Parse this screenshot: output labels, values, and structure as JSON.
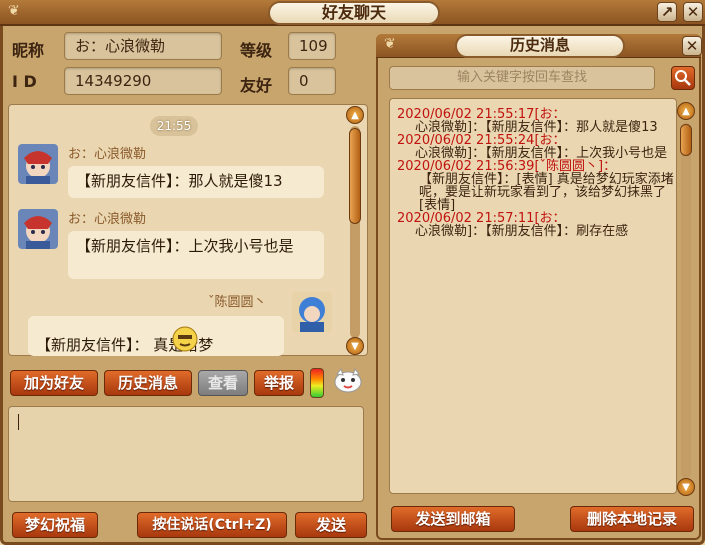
{
  "window": {
    "title": "好友聊天"
  },
  "profile": {
    "nickname_label": "昵称",
    "nickname_value": "お：心浪微勒",
    "level_label": "等级",
    "level_value": "109",
    "id_label": "I D",
    "id_value": "14349290",
    "friendship_label": "友好",
    "friendship_value": "0"
  },
  "chat": {
    "time": "21:55",
    "messages": [
      {
        "sender": "お：心浪微勒",
        "text": "【新朋友信件】：那人就是傻13"
      },
      {
        "sender": "お：心浪微勒",
        "text": "【新朋友信件】：上次我小号也是"
      },
      {
        "sender": "ˇ陈圆圆丶",
        "text": "【新朋友信件】：  真是给梦"
      }
    ]
  },
  "toolbar": {
    "add_friend": "加为好友",
    "history": "历史消息",
    "view": "查看",
    "report": "举报"
  },
  "bottom": {
    "blessing": "梦幻祝福",
    "voice": "按住说话(Ctrl+Z)",
    "send": "发送"
  },
  "history": {
    "title": "历史消息",
    "search_placeholder": "输入关键字按回车查找",
    "entries": [
      {
        "time": "2020/06/02 21:55:17[お：",
        "body": "心浪微勒]：【新朋友信件】：那人就是傻13"
      },
      {
        "time": "2020/06/02 21:55:24[お：",
        "body": "心浪微勒]：【新朋友信件】：上次我小号也是"
      },
      {
        "time": "2020/06/02 21:56:39[ˇ陈圆圆丶]：",
        "body": "【新朋友信件】：[表情] 真是给梦幻玩家添堵呢，要是让新玩家看到了，该给梦幻抹黑了[表情]"
      },
      {
        "time": "2020/06/02 21:57:11[お：",
        "body": "心浪微勒]：【新朋友信件】：刷存在感"
      }
    ],
    "send_mail": "发送到邮箱",
    "delete_local": "删除本地记录"
  },
  "colors": {
    "accent": "#c0120e",
    "button": "#c2501c",
    "frame": "#7a4a1f"
  }
}
